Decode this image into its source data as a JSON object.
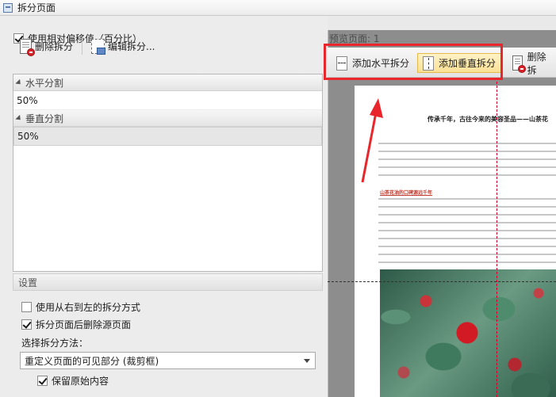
{
  "window": {
    "title": "拆分页面"
  },
  "options": {
    "relative_offset_label": "使用相对偏移值（百分比）",
    "relative_offset_checked": true
  },
  "left_toolbar": {
    "delete_split": "删除拆分",
    "edit_split": "编辑拆分..."
  },
  "split_list": {
    "horizontal_header": "水平分割",
    "horizontal_items": [
      "50%"
    ],
    "vertical_header": "垂直分割",
    "vertical_items": [
      "50%"
    ]
  },
  "settings": {
    "header": "设置",
    "rtl_label": "使用从右到左的拆分方式",
    "rtl_checked": false,
    "delete_source_label": "拆分页面后删除源页面",
    "delete_source_checked": true,
    "method_label": "选择拆分方法：",
    "method_value": "重定义页面的可见部分 (裁剪框)",
    "keep_original_label": "保留原始内容",
    "keep_original_checked": true
  },
  "preview": {
    "label": "预览页面: 1",
    "add_horizontal": "添加水平拆分",
    "add_vertical": "添加垂直拆分",
    "delete_split": "删除拆",
    "doc_title": "传承千年，古往今来的美容圣品——山茶花",
    "doc_subtitle": "山茶花油的口碑源远千年"
  }
}
